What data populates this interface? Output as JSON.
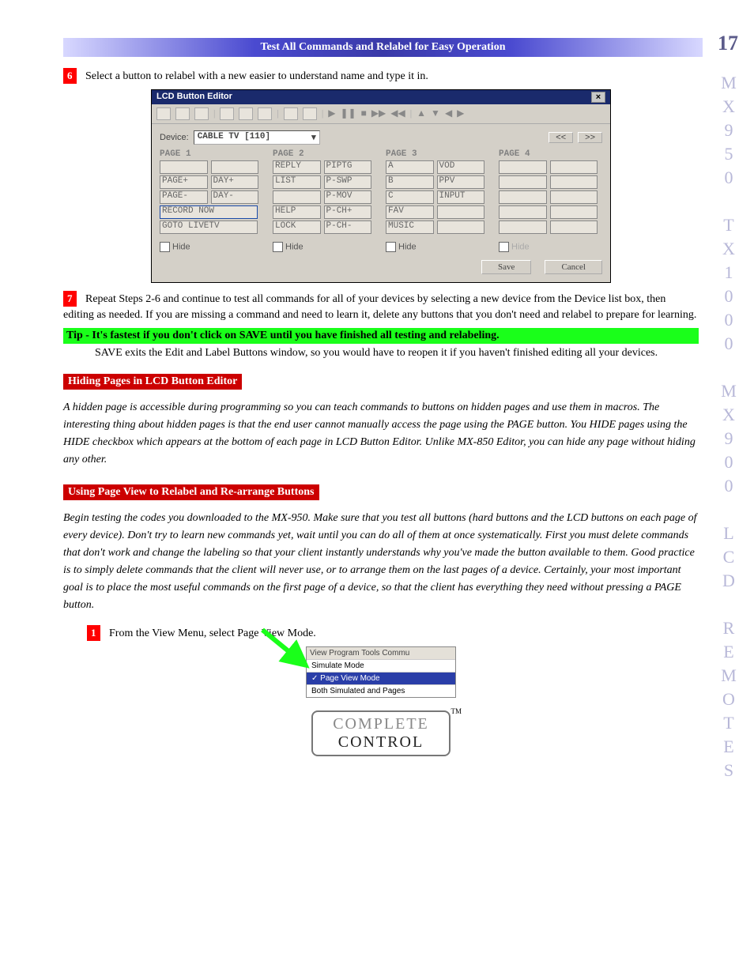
{
  "page_number": "17",
  "header_title": "Test All Commands and Relabel for Easy Operation",
  "side_label": "M\nX\n9\n5\n0\n\nT\nX\n1\n0\n0\n0\n\nM\nX\n9\n0\n0\n\nL\nC\nD\n\nR\nE\nM\nO\nT\nE\nS",
  "step6": {
    "num": "6",
    "text": "Select a button to relabel with a new easier to understand name and type it in."
  },
  "editor": {
    "title": "LCD Button Editor",
    "device_label": "Device:",
    "device_value": "CABLE TV [110]",
    "nav_prev": "<<",
    "nav_next": ">>",
    "pages": [
      {
        "title": "PAGE 1",
        "rows": [
          {
            "l": "",
            "r": ""
          },
          {
            "l": "PAGE+",
            "r": "DAY+"
          },
          {
            "l": "PAGE-",
            "r": "DAY-"
          },
          {
            "wide": "RECORD NOW",
            "hi": true
          },
          {
            "wide": "GOTO LIVETV"
          }
        ],
        "hide": "Hide"
      },
      {
        "title": "PAGE 2",
        "rows": [
          {
            "l": "REPLY",
            "r": "PIPTG"
          },
          {
            "l": "LIST",
            "r": "P-SWP"
          },
          {
            "l": "",
            "r": "P-MOV"
          },
          {
            "l": "HELP",
            "r": "P-CH+"
          },
          {
            "l": "LOCK",
            "r": "P-CH-"
          }
        ],
        "hide": "Hide"
      },
      {
        "title": "PAGE 3",
        "rows": [
          {
            "l": "A",
            "r": "VOD"
          },
          {
            "l": "B",
            "r": "PPV"
          },
          {
            "l": "C",
            "r": "INPUT"
          },
          {
            "l": "FAV",
            "r": ""
          },
          {
            "l": "MUSIC",
            "r": ""
          }
        ],
        "hide": "Hide"
      },
      {
        "title": "PAGE 4",
        "rows": [
          {
            "l": "",
            "r": ""
          },
          {
            "l": "",
            "r": ""
          },
          {
            "l": "",
            "r": ""
          },
          {
            "l": "",
            "r": ""
          },
          {
            "l": "",
            "r": ""
          }
        ],
        "hide": "Hide",
        "disabled": true
      }
    ],
    "save": "Save",
    "cancel": "Cancel"
  },
  "step7": {
    "num": "7",
    "text": "Repeat Steps 2-6 and continue to test all commands for all of your devices by selecting a new device from the Device list box, then editing as needed. If you are missing a command and need to learn it, delete any buttons that you don't need and relabel to prepare for learning."
  },
  "tip": {
    "title": "Tip - It's fastest if you don't click on SAVE until you have finished all testing and relabeling.",
    "body": "SAVE exits the Edit and Label Buttons window, so you would have to reopen it if you haven't finished editing all your devices."
  },
  "hiding": {
    "title": "Hiding Pages in LCD Button Editor",
    "body": "A hidden page is accessible during programming so you can teach commands to buttons on hidden pages and use them in macros. The interesting thing about hidden pages is that the end user cannot manually access the page using the PAGE button.  You HIDE pages using the HIDE checkbox which appears at the bottom of each page in LCD Button Editor. Unlike MX-850 Editor, you can hide any page without hiding any other."
  },
  "pageview": {
    "title": "Using Page View to Relabel and Re-arrange Buttons",
    "body": " Begin testing the codes you downloaded to the MX-950.  Make sure that you test all buttons (hard buttons and the LCD buttons on each page of every device). Don't try to learn new commands yet, wait until you can do all of them at once systematically. First you must delete commands that don't work and change the labeling so that your client instantly understands why you've made the button available to them. Good practice is to simply delete commands that the client will never use, or to arrange them on the last pages of a device. Certainly, your most important goal is to place the most useful commands on the first page of a device, so that the client has everything they need without pressing a PAGE button."
  },
  "step1": {
    "num": "1",
    "text": "From the View Menu, select Page View Mode."
  },
  "menu": {
    "bar": "View   Program   Tools   Commu",
    "items": [
      "Simulate Mode",
      "Page View Mode",
      "Both Simulated and Pages"
    ],
    "selected": 1
  },
  "logo": {
    "top": "COMPLETE",
    "bottom": "CONTROL",
    "tm": "TM"
  }
}
